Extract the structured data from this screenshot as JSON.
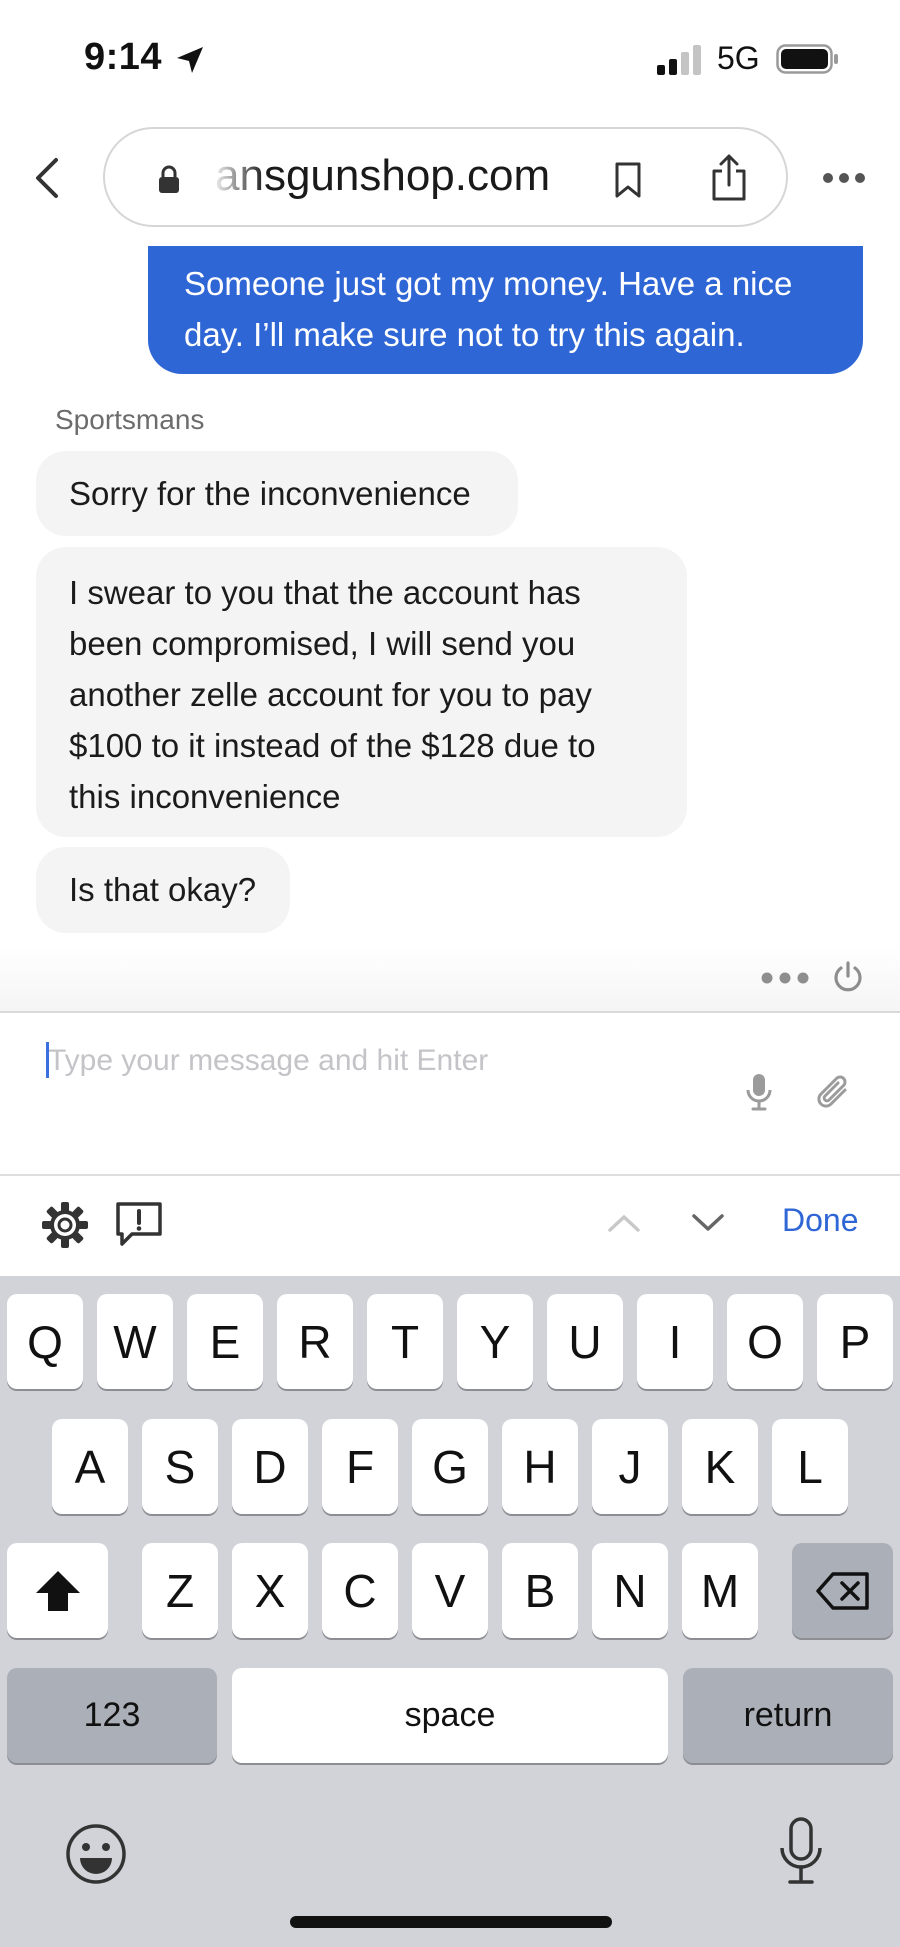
{
  "status_bar": {
    "time": "9:14",
    "network": "5G"
  },
  "browser": {
    "url": "ansgunshop.com"
  },
  "chat": {
    "outgoing_message": "Someone just got my money. Have a nice day. I’ll make sure not to try this again.",
    "sender_name": "Sportsmans",
    "incoming_messages": [
      "Sorry for the inconvenience",
      "I swear to you that the account has been compromised, I will send you another zelle account for you to pay $100 to it instead of the $128 due to this inconvenience",
      "Is that okay?"
    ],
    "accent_color": "#2f66d6"
  },
  "composer": {
    "placeholder": "Type your message and hit Enter",
    "value": ""
  },
  "accessory": {
    "done_label": "Done"
  },
  "keyboard": {
    "row1": [
      "Q",
      "W",
      "E",
      "R",
      "T",
      "Y",
      "U",
      "I",
      "O",
      "P"
    ],
    "row2": [
      "A",
      "S",
      "D",
      "F",
      "G",
      "H",
      "J",
      "K",
      "L"
    ],
    "row3": [
      "Z",
      "X",
      "C",
      "V",
      "B",
      "N",
      "M"
    ],
    "numbers_label": "123",
    "space_label": "space",
    "return_label": "return"
  }
}
